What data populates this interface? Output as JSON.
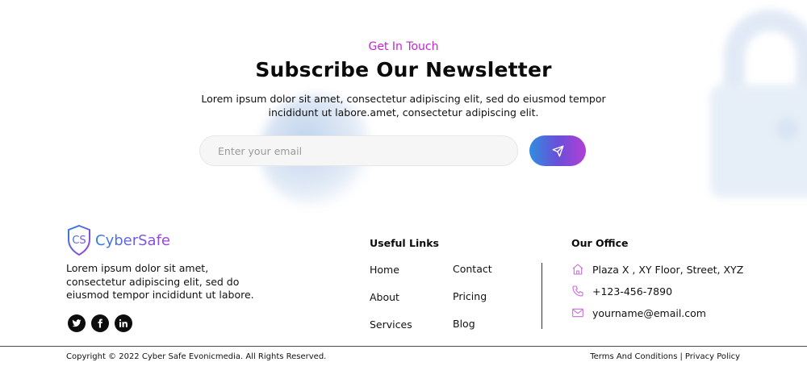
{
  "newsletter": {
    "eyebrow": "Get In Touch",
    "title": "Subscribe Our Newsletter",
    "description": "Lorem ipsum dolor sit amet, consectetur adipiscing elit, sed do eiusmod tempor incididunt ut labore.amet, consectetur adipiscing elit.",
    "email_placeholder": "Enter your email",
    "email_value": "",
    "submit_icon": "send-icon"
  },
  "brand": {
    "name": "CyberSafe",
    "logo_letters": "CS",
    "about": "Lorem ipsum dolor sit amet, consectetur adipiscing elit, sed do eiusmod tempor incididunt ut labore.",
    "social": [
      "twitter-icon",
      "facebook-icon",
      "linkedin-icon"
    ]
  },
  "useful_links": {
    "title": "Useful Links",
    "col1": [
      "Home",
      "About",
      "Services"
    ],
    "col2": [
      "Contact",
      "Pricing",
      "Blog"
    ]
  },
  "office": {
    "title": "Our Office",
    "address": "Plaza X , XY Floor, Street, XYZ",
    "phone": "+123-456-7890",
    "email": "yourname@email.com"
  },
  "footer": {
    "copyright": "Copyright © 2022 Cyber Safe Evonicmedia. All Rights Reserved.",
    "terms": "Terms And Conditions",
    "separator": "|",
    "privacy": "Privacy Policy"
  },
  "colors": {
    "accent_magenta": "#c026d3",
    "gradient_start": "#2f8ee0",
    "gradient_end": "#b13fd6",
    "icon_pink": "#c86ad6"
  }
}
